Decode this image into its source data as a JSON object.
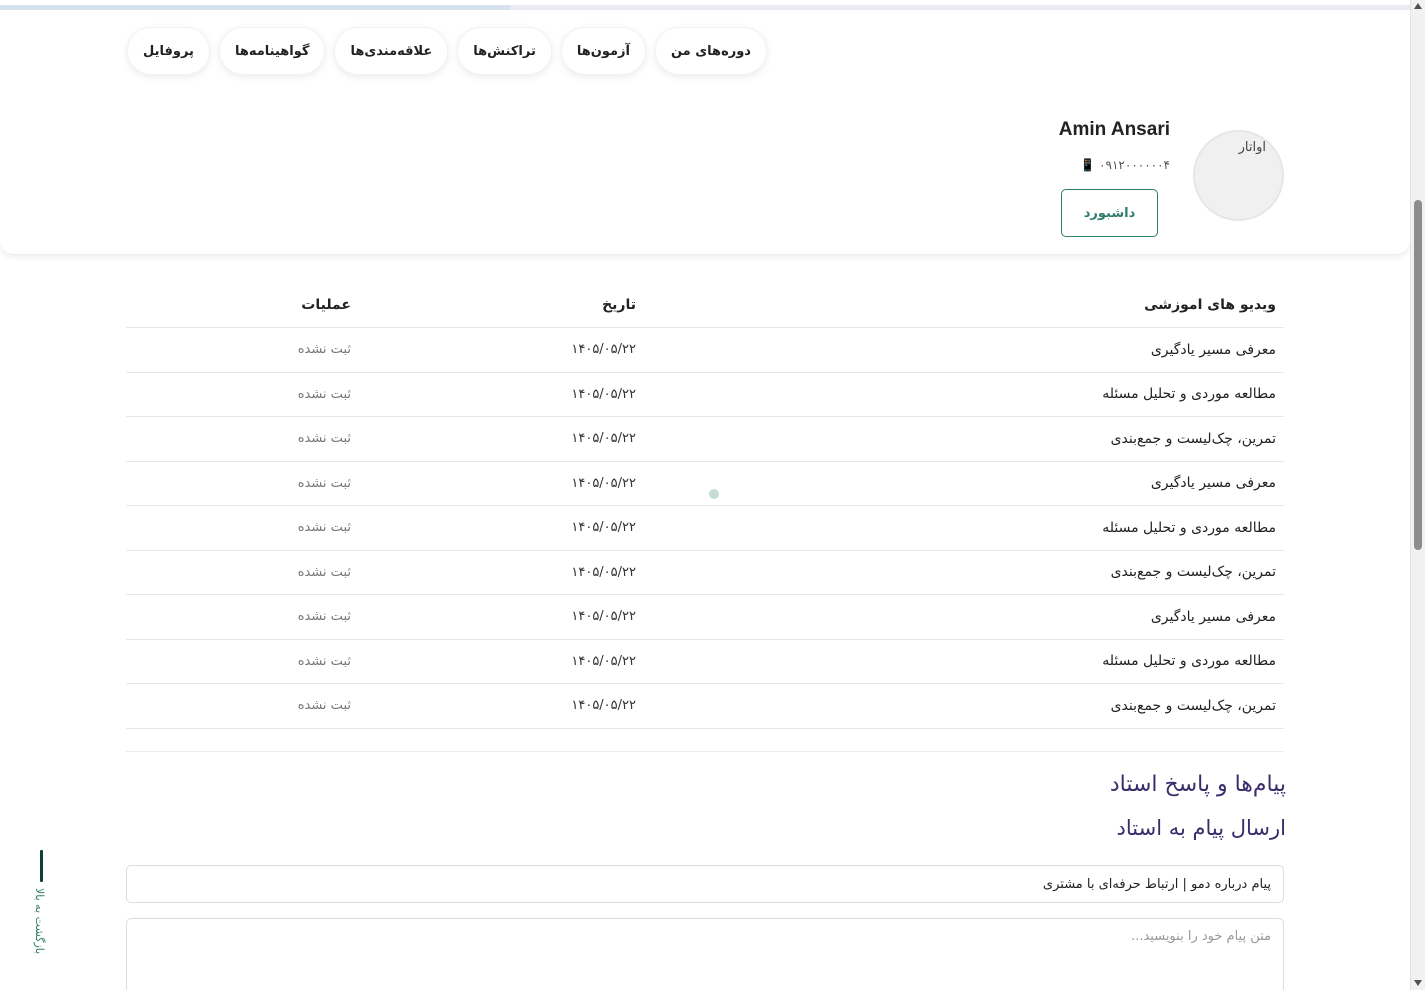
{
  "tabs": [
    {
      "label": "دوره‌های من"
    },
    {
      "label": "آزمون‌ها"
    },
    {
      "label": "تراکنش‌ها"
    },
    {
      "label": "علاقه‌مندی‌ها"
    },
    {
      "label": "گواهینامه‌ها"
    },
    {
      "label": "پروفایل"
    }
  ],
  "profile": {
    "name": "Amin Ansari",
    "phone": "۰۹۱۲۰۰۰۰۰۰۴ 📱",
    "avatar_alt": "اواتار",
    "dashboard_label": "داشبورد"
  },
  "table": {
    "headers": {
      "title": "ویدیو های اموزشی",
      "date": "تاریخ",
      "ops": "عملیات"
    },
    "rows": [
      {
        "title": "معرفی مسیر یادگیری",
        "date": "۱۴۰۵/۰۵/۲۲",
        "status": "ثبت نشده"
      },
      {
        "title": "مطالعه موردی و تحلیل مسئله",
        "date": "۱۴۰۵/۰۵/۲۲",
        "status": "ثبت نشده"
      },
      {
        "title": "تمرین، چک‌لیست و جمع‌بندی",
        "date": "۱۴۰۵/۰۵/۲۲",
        "status": "ثبت نشده"
      },
      {
        "title": "معرفی مسیر یادگیری",
        "date": "۱۴۰۵/۰۵/۲۲",
        "status": "ثبت نشده"
      },
      {
        "title": "مطالعه موردی و تحلیل مسئله",
        "date": "۱۴۰۵/۰۵/۲۲",
        "status": "ثبت نشده"
      },
      {
        "title": "تمرین، چک‌لیست و جمع‌بندی",
        "date": "۱۴۰۵/۰۵/۲۲",
        "status": "ثبت نشده"
      },
      {
        "title": "معرفی مسیر یادگیری",
        "date": "۱۴۰۵/۰۵/۲۲",
        "status": "ثبت نشده"
      },
      {
        "title": "مطالعه موردی و تحلیل مسئله",
        "date": "۱۴۰۵/۰۵/۲۲",
        "status": "ثبت نشده"
      },
      {
        "title": "تمرین، چک‌لیست و جمع‌بندی",
        "date": "۱۴۰۵/۰۵/۲۲",
        "status": "ثبت نشده"
      }
    ]
  },
  "messages": {
    "title": "پیام‌ها و پاسخ استاد",
    "subtitle": "ارسال پیام به استاد",
    "subject_value": "پیام درباره دمو | ارتباط حرفه‌ای با مشتری",
    "body_placeholder": "متن پیام خود را بنویسید..."
  },
  "back_to_top": {
    "label": "بازگشت به بالا"
  },
  "colors": {
    "accent": "#2f7d6b",
    "heading": "#3b2d6b"
  }
}
